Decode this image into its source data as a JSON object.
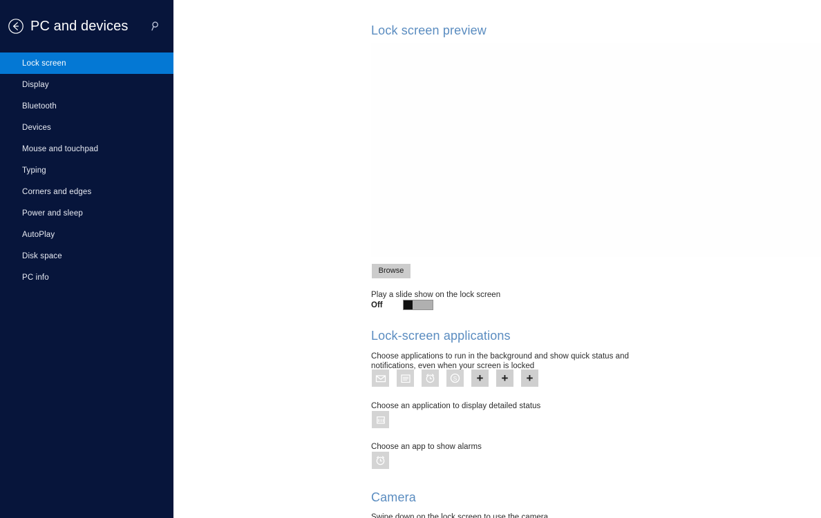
{
  "sidebar": {
    "back_icon": "back-arrow-circle-icon",
    "title": "PC and devices",
    "search_icon": "search-icon",
    "items": [
      {
        "label": "Lock screen",
        "selected": true
      },
      {
        "label": "Display",
        "selected": false
      },
      {
        "label": "Bluetooth",
        "selected": false
      },
      {
        "label": "Devices",
        "selected": false
      },
      {
        "label": "Mouse and touchpad",
        "selected": false
      },
      {
        "label": "Typing",
        "selected": false
      },
      {
        "label": "Corners and edges",
        "selected": false
      },
      {
        "label": "Power and sleep",
        "selected": false
      },
      {
        "label": "AutoPlay",
        "selected": false
      },
      {
        "label": "Disk space",
        "selected": false
      },
      {
        "label": "PC info",
        "selected": false
      }
    ]
  },
  "main": {
    "preview": {
      "title": "Lock screen preview",
      "browse_label": "Browse"
    },
    "slideshow": {
      "label": "Play a slide show on the lock screen",
      "state": "Off"
    },
    "lock_screen_apps": {
      "title": "Lock-screen applications",
      "description": "Choose applications to run in the background and show quick status and notifications, even when your screen is locked",
      "tiles": [
        {
          "icon": "mail-icon",
          "glyph": ""
        },
        {
          "icon": "calendar-icon",
          "glyph": ""
        },
        {
          "icon": "alarm-clock-icon",
          "glyph": ""
        },
        {
          "icon": "skype-icon",
          "glyph": ""
        },
        {
          "icon": "add-icon",
          "glyph": "+"
        },
        {
          "icon": "add-icon",
          "glyph": "+"
        },
        {
          "icon": "add-icon",
          "glyph": "+"
        }
      ]
    },
    "detailed_status": {
      "description": "Choose an application to display detailed status",
      "tile_icon": "calendar-icon"
    },
    "alarms": {
      "description": "Choose an app to show alarms",
      "tile_icon": "alarm-clock-icon"
    },
    "camera": {
      "title": "Camera",
      "description": "Swipe down on the lock screen to use the camera"
    }
  },
  "colors": {
    "sidebar_bg": "#07153b",
    "accent": "#0478d4",
    "heading": "#5a8cc0",
    "tile_bg": "#d4d4d4",
    "button_bg": "#cccccc"
  }
}
